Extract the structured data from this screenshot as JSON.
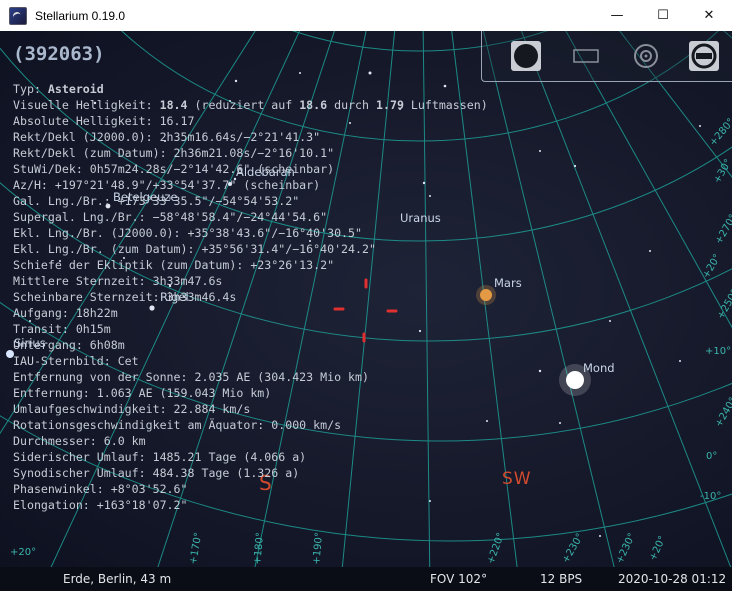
{
  "window": {
    "title": "Stellarium 0.19.0",
    "minimize_glyph": "—",
    "maximize_glyph": "☐",
    "close_glyph": "✕"
  },
  "object": {
    "title": "(392063)",
    "type_label": "Typ: ",
    "type_value": "Asteroid",
    "magnitude": {
      "prefix": "Visuelle Helligkeit: ",
      "value": "18.4",
      "mid1": " (reduziert auf ",
      "reduced": "18.6",
      "mid2": " durch ",
      "airmass": "1.79",
      "suffix": " Luftmassen)"
    },
    "lines": [
      "Absolute Helligkeit: 16.17",
      "Rekt/Dekl (J2000.0): 2h35m16.64s/−2°21'41.3\"",
      "Rekt/Dekl (zum Datum): 2h36m21.08s/−2°16'10.1\"",
      "StuWi/Dek: 0h57m24.28s/−2°14'42.6\" (scheinbar)",
      "Az/H: +197°21'48.9\"/+33°54'37.7\" (scheinbar)",
      "Gal. Lng./Br.: +173°33'35.5\"/−54°54'53.2\"",
      "Supergal. Lng./Br.: −58°48'58.4\"/−24°44'54.6\"",
      "Ekl. Lng./Br. (J2000.0): +35°38'43.6\"/−16°40'30.5\"",
      "Ekl. Lng./Br. (zum Datum): +35°56'31.4\"/−16°40'24.2\"",
      "Schiefe der Ekliptik (zum Datum): +23°26'13.2\"",
      "Mittlere Sternzeit: 3h33m47.6s",
      "Scheinbare Sternzeit: 3h33m46.4s",
      "Aufgang: 18h22m",
      "Transit: 0h15m",
      "Untergang: 6h08m",
      "IAU-Sternbild: Cet",
      "Entfernung von der Sonne: 2.035 AE (304.423 Mio km)",
      "Entfernung: 1.063 AE (159.043 Mio km)",
      "Umlaufgeschwindigkeit: 22.884 km/s",
      "Rotationsgeschwindigkeit am Äquator: 0.000 km/s",
      "Durchmesser: 6.0 km",
      "Siderischer Umlauf: 1485.21 Tage (4.066 a)",
      "Synodischer Umlauf: 484.38 Tage (1.326 a)",
      "Phasenwinkel: +8°03'52.6\"",
      "Elongation: +163°18'07.2\""
    ]
  },
  "sky_labels": {
    "aldebaran": "Aldebaran",
    "betelgeuse": "Betelgeuze",
    "uranus": "Uranus",
    "mars": "Mars",
    "rigel": "Rigel",
    "sirius": "Sirius",
    "mond": "Mond"
  },
  "cardinals": {
    "south": "S",
    "southwest": "SW"
  },
  "grid_labels": {
    "r1": "+280°",
    "r2": "+30°",
    "r3": "+270°",
    "r4": "+20°",
    "r5": "+250°",
    "r6": "+10°",
    "r7": "+240°",
    "r8": "0°",
    "r9": "-10°",
    "r10": "+230°",
    "r11": "+20°",
    "b1": "+170°",
    "b2": "+180°",
    "b3": "+190°",
    "b4": "+220°",
    "b5": "+230°",
    "b6": "+20°"
  },
  "toolbar": {
    "icons": [
      "dark-circle-icon",
      "rectangle-icon",
      "target-icon",
      "exit-icon"
    ]
  },
  "status": {
    "location": "Erde, Berlin, 43 m",
    "fov": "FOV 102°",
    "fps": "12 BPS",
    "datetime": "2020-10-28 01:12"
  },
  "colors": {
    "grid": "#1e9e96",
    "cardinal": "#d24a2d",
    "marker": "#e03030",
    "text": "#c5ccd6"
  }
}
